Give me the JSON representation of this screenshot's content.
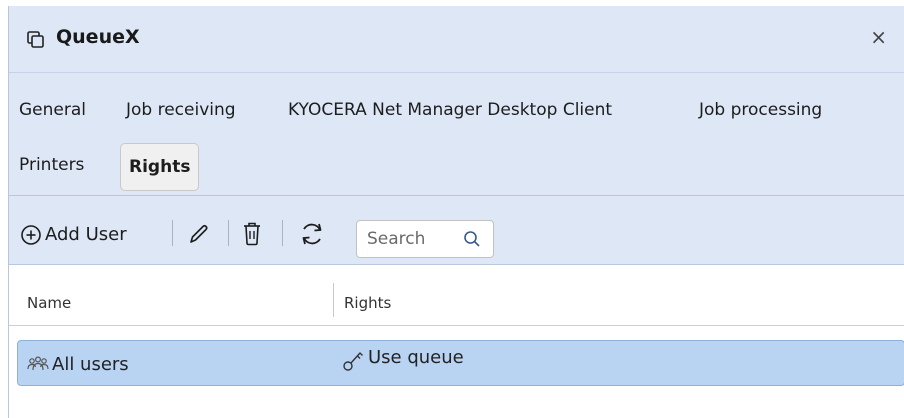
{
  "window": {
    "title": "QueueX",
    "close_glyph": "×"
  },
  "tabs": [
    {
      "label": "General",
      "active": false
    },
    {
      "label": "Job receiving",
      "active": false
    },
    {
      "label": "KYOCERA Net Manager Desktop Client",
      "active": false
    },
    {
      "label": "Job processing",
      "active": false
    },
    {
      "label": "Printers",
      "active": false
    },
    {
      "label": "Rights",
      "active": true
    }
  ],
  "toolbar": {
    "add_user_label": "Add User",
    "search_placeholder": "Search",
    "icons": [
      "add-circle-icon",
      "pencil-icon",
      "trash-icon",
      "refresh-icon",
      "search-icon"
    ]
  },
  "table": {
    "columns": [
      "Name",
      "Rights"
    ],
    "rows": [
      {
        "name": "All users",
        "name_icon": "users-group-icon",
        "rights": "Use queue",
        "rights_icon": "key-icon",
        "selected": true
      }
    ]
  },
  "colors": {
    "header_bg": "#dde7f6",
    "selected_row_bg": "#b9d3f3",
    "selected_row_border": "#8fb0db"
  }
}
